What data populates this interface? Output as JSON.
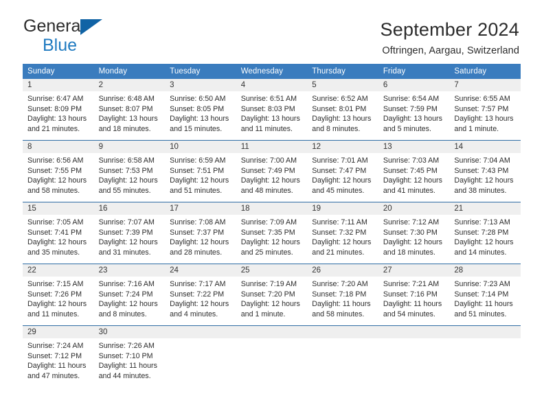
{
  "logo": {
    "word1": "General",
    "word2": "Blue",
    "triangle": "blue-triangle-icon"
  },
  "header": {
    "title": "September 2024",
    "subtitle": "Oftringen, Aargau, Switzerland"
  },
  "colors": {
    "header_blue": "#3a7cbe",
    "row_border_blue": "#2e6ca4",
    "daynum_gray": "#efefef",
    "logo_blue": "#1f7ac0"
  },
  "weekdays": [
    "Sunday",
    "Monday",
    "Tuesday",
    "Wednesday",
    "Thursday",
    "Friday",
    "Saturday"
  ],
  "weeks": [
    [
      {
        "day": "1",
        "sunrise": "Sunrise: 6:47 AM",
        "sunset": "Sunset: 8:09 PM",
        "daylight1": "Daylight: 13 hours",
        "daylight2": "and 21 minutes."
      },
      {
        "day": "2",
        "sunrise": "Sunrise: 6:48 AM",
        "sunset": "Sunset: 8:07 PM",
        "daylight1": "Daylight: 13 hours",
        "daylight2": "and 18 minutes."
      },
      {
        "day": "3",
        "sunrise": "Sunrise: 6:50 AM",
        "sunset": "Sunset: 8:05 PM",
        "daylight1": "Daylight: 13 hours",
        "daylight2": "and 15 minutes."
      },
      {
        "day": "4",
        "sunrise": "Sunrise: 6:51 AM",
        "sunset": "Sunset: 8:03 PM",
        "daylight1": "Daylight: 13 hours",
        "daylight2": "and 11 minutes."
      },
      {
        "day": "5",
        "sunrise": "Sunrise: 6:52 AM",
        "sunset": "Sunset: 8:01 PM",
        "daylight1": "Daylight: 13 hours",
        "daylight2": "and 8 minutes."
      },
      {
        "day": "6",
        "sunrise": "Sunrise: 6:54 AM",
        "sunset": "Sunset: 7:59 PM",
        "daylight1": "Daylight: 13 hours",
        "daylight2": "and 5 minutes."
      },
      {
        "day": "7",
        "sunrise": "Sunrise: 6:55 AM",
        "sunset": "Sunset: 7:57 PM",
        "daylight1": "Daylight: 13 hours",
        "daylight2": "and 1 minute."
      }
    ],
    [
      {
        "day": "8",
        "sunrise": "Sunrise: 6:56 AM",
        "sunset": "Sunset: 7:55 PM",
        "daylight1": "Daylight: 12 hours",
        "daylight2": "and 58 minutes."
      },
      {
        "day": "9",
        "sunrise": "Sunrise: 6:58 AM",
        "sunset": "Sunset: 7:53 PM",
        "daylight1": "Daylight: 12 hours",
        "daylight2": "and 55 minutes."
      },
      {
        "day": "10",
        "sunrise": "Sunrise: 6:59 AM",
        "sunset": "Sunset: 7:51 PM",
        "daylight1": "Daylight: 12 hours",
        "daylight2": "and 51 minutes."
      },
      {
        "day": "11",
        "sunrise": "Sunrise: 7:00 AM",
        "sunset": "Sunset: 7:49 PM",
        "daylight1": "Daylight: 12 hours",
        "daylight2": "and 48 minutes."
      },
      {
        "day": "12",
        "sunrise": "Sunrise: 7:01 AM",
        "sunset": "Sunset: 7:47 PM",
        "daylight1": "Daylight: 12 hours",
        "daylight2": "and 45 minutes."
      },
      {
        "day": "13",
        "sunrise": "Sunrise: 7:03 AM",
        "sunset": "Sunset: 7:45 PM",
        "daylight1": "Daylight: 12 hours",
        "daylight2": "and 41 minutes."
      },
      {
        "day": "14",
        "sunrise": "Sunrise: 7:04 AM",
        "sunset": "Sunset: 7:43 PM",
        "daylight1": "Daylight: 12 hours",
        "daylight2": "and 38 minutes."
      }
    ],
    [
      {
        "day": "15",
        "sunrise": "Sunrise: 7:05 AM",
        "sunset": "Sunset: 7:41 PM",
        "daylight1": "Daylight: 12 hours",
        "daylight2": "and 35 minutes."
      },
      {
        "day": "16",
        "sunrise": "Sunrise: 7:07 AM",
        "sunset": "Sunset: 7:39 PM",
        "daylight1": "Daylight: 12 hours",
        "daylight2": "and 31 minutes."
      },
      {
        "day": "17",
        "sunrise": "Sunrise: 7:08 AM",
        "sunset": "Sunset: 7:37 PM",
        "daylight1": "Daylight: 12 hours",
        "daylight2": "and 28 minutes."
      },
      {
        "day": "18",
        "sunrise": "Sunrise: 7:09 AM",
        "sunset": "Sunset: 7:35 PM",
        "daylight1": "Daylight: 12 hours",
        "daylight2": "and 25 minutes."
      },
      {
        "day": "19",
        "sunrise": "Sunrise: 7:11 AM",
        "sunset": "Sunset: 7:32 PM",
        "daylight1": "Daylight: 12 hours",
        "daylight2": "and 21 minutes."
      },
      {
        "day": "20",
        "sunrise": "Sunrise: 7:12 AM",
        "sunset": "Sunset: 7:30 PM",
        "daylight1": "Daylight: 12 hours",
        "daylight2": "and 18 minutes."
      },
      {
        "day": "21",
        "sunrise": "Sunrise: 7:13 AM",
        "sunset": "Sunset: 7:28 PM",
        "daylight1": "Daylight: 12 hours",
        "daylight2": "and 14 minutes."
      }
    ],
    [
      {
        "day": "22",
        "sunrise": "Sunrise: 7:15 AM",
        "sunset": "Sunset: 7:26 PM",
        "daylight1": "Daylight: 12 hours",
        "daylight2": "and 11 minutes."
      },
      {
        "day": "23",
        "sunrise": "Sunrise: 7:16 AM",
        "sunset": "Sunset: 7:24 PM",
        "daylight1": "Daylight: 12 hours",
        "daylight2": "and 8 minutes."
      },
      {
        "day": "24",
        "sunrise": "Sunrise: 7:17 AM",
        "sunset": "Sunset: 7:22 PM",
        "daylight1": "Daylight: 12 hours",
        "daylight2": "and 4 minutes."
      },
      {
        "day": "25",
        "sunrise": "Sunrise: 7:19 AM",
        "sunset": "Sunset: 7:20 PM",
        "daylight1": "Daylight: 12 hours",
        "daylight2": "and 1 minute."
      },
      {
        "day": "26",
        "sunrise": "Sunrise: 7:20 AM",
        "sunset": "Sunset: 7:18 PM",
        "daylight1": "Daylight: 11 hours",
        "daylight2": "and 58 minutes."
      },
      {
        "day": "27",
        "sunrise": "Sunrise: 7:21 AM",
        "sunset": "Sunset: 7:16 PM",
        "daylight1": "Daylight: 11 hours",
        "daylight2": "and 54 minutes."
      },
      {
        "day": "28",
        "sunrise": "Sunrise: 7:23 AM",
        "sunset": "Sunset: 7:14 PM",
        "daylight1": "Daylight: 11 hours",
        "daylight2": "and 51 minutes."
      }
    ],
    [
      {
        "day": "29",
        "sunrise": "Sunrise: 7:24 AM",
        "sunset": "Sunset: 7:12 PM",
        "daylight1": "Daylight: 11 hours",
        "daylight2": "and 47 minutes."
      },
      {
        "day": "30",
        "sunrise": "Sunrise: 7:26 AM",
        "sunset": "Sunset: 7:10 PM",
        "daylight1": "Daylight: 11 hours",
        "daylight2": "and 44 minutes."
      },
      {
        "day": "",
        "sunrise": "",
        "sunset": "",
        "daylight1": "",
        "daylight2": ""
      },
      {
        "day": "",
        "sunrise": "",
        "sunset": "",
        "daylight1": "",
        "daylight2": ""
      },
      {
        "day": "",
        "sunrise": "",
        "sunset": "",
        "daylight1": "",
        "daylight2": ""
      },
      {
        "day": "",
        "sunrise": "",
        "sunset": "",
        "daylight1": "",
        "daylight2": ""
      },
      {
        "day": "",
        "sunrise": "",
        "sunset": "",
        "daylight1": "",
        "daylight2": ""
      }
    ]
  ]
}
